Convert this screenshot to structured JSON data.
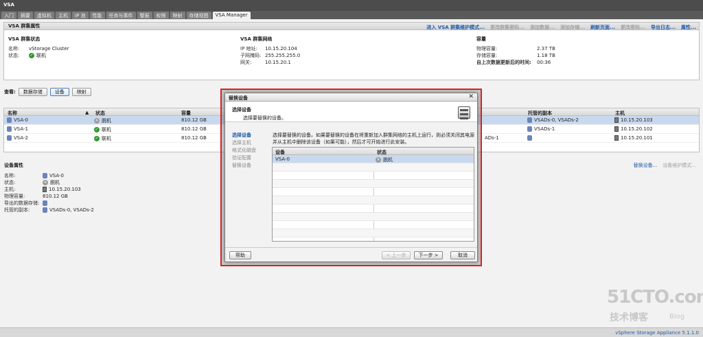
{
  "app": {
    "title": "VSA"
  },
  "tabs": [
    "入门",
    "摘要",
    "虚拟机",
    "主机",
    "IP 池",
    "性能",
    "任务与事件",
    "警报",
    "权限",
    "映射",
    "存储视图",
    "VSA Manager"
  ],
  "top_panel": {
    "header": "VSA 群集属性",
    "links": [
      {
        "label": "进入 VSA 群集维护模式...",
        "enabled": true
      },
      {
        "label": "更改群集密码...",
        "enabled": false
      },
      {
        "label": "添加数据...",
        "enabled": false
      },
      {
        "label": "添加存储...",
        "enabled": false
      },
      {
        "label": "刷新页面...",
        "enabled": true
      },
      {
        "label": "更改密码...",
        "enabled": false
      },
      {
        "label": "导出日志...",
        "enabled": true
      },
      {
        "label": "属性...",
        "enabled": true
      }
    ],
    "cluster_status": {
      "title": "VSA 群集状态",
      "name_label": "名称:",
      "name_value": "vStorage Cluster",
      "state_label": "状态:",
      "state_value": "联机"
    },
    "network": {
      "title": "VSA 群集网络",
      "ip_label": "IP 地址:",
      "ip_value": "10.15.20.104",
      "mask_label": "子网掩码:",
      "mask_value": "255.255.255.0",
      "gw_label": "网关:",
      "gw_value": "10.15.20.1"
    },
    "capacity": {
      "title": "容量",
      "phys_label": "物理容量:",
      "phys_value": "2.37 TB",
      "store_label": "存储容量:",
      "store_value": "1.18 TB",
      "update_label": "自上次数据更新后的时间:",
      "update_value": "00:36"
    }
  },
  "view_bar": {
    "label": "查看:",
    "buttons": [
      "数据存储",
      "设备",
      "映射"
    ]
  },
  "grid": {
    "headers": {
      "name": "名称",
      "state": "状态",
      "capacity": "容量",
      "replicas": "托管的副本",
      "host": "主机"
    },
    "rows": [
      {
        "name": "VSA-0",
        "state": "脱机",
        "state_kind": "off",
        "capacity": "810.12 GB",
        "replicas": "VSADs-0, VSADs-2",
        "host": "10.15.20.103",
        "selected": true
      },
      {
        "name": "VSA-1",
        "state": "联机",
        "state_kind": "ok",
        "capacity": "810.12 GB",
        "replicas": "VSADs-1",
        "host": "10.15.20.102",
        "selected": false
      },
      {
        "name": "VSA-2",
        "state": "联机",
        "state_kind": "ok",
        "capacity": "810.12 GB",
        "replicas": "",
        "host": "10.15.20.101",
        "selected": false,
        "hidden_mid": "ADs-1"
      }
    ]
  },
  "device_props": {
    "title": "设备属性",
    "links": [
      {
        "label": "替换设备...",
        "enabled": true
      },
      {
        "label": "设备维护模式...",
        "enabled": false
      }
    ],
    "items": [
      {
        "k": "名称:",
        "v": "VSA-0"
      },
      {
        "k": "状态:",
        "v": "脱机"
      },
      {
        "k": "主机:",
        "v": "10.15.20.103"
      },
      {
        "k": "物理容量:",
        "v": "810.12 GB"
      },
      {
        "k": "导出的数据存储:",
        "v": ""
      },
      {
        "k": "托管的副本:",
        "v": "VSADs-0, VSADs-2"
      }
    ]
  },
  "dialog": {
    "title": "替换设备",
    "header_title": "选择设备",
    "header_sub": "选择要替换的设备。",
    "steps": [
      "选择设备",
      "选择主机",
      "格式化磁盘",
      "验证配置",
      "替换设备"
    ],
    "instruction": "选择要替换的设备。如果要替换的设备在将重新加入群集网络的主机上运行，则必须关闭其电源并从主机中删除该设备（如果可能），然后才可开始进行此安装。",
    "table_headers": {
      "device": "设备",
      "state": "状态"
    },
    "table_rows": [
      {
        "device": "VSA-0",
        "state": "脱机"
      }
    ],
    "buttons": {
      "help": "帮助",
      "back": "< 上一步",
      "next": "下一步 >",
      "cancel": "取消"
    }
  },
  "status_bar": {
    "text": "vSphere Storage Appliance 5.1.1.0"
  },
  "watermark": {
    "line1": "51CTO.com",
    "line2": "技术博客",
    "line3": "Blog"
  },
  "colors": {
    "selection": "#c8d9ef",
    "link": "#1f5aa8",
    "highlight_border": "#e02020",
    "online": "#2e9a2e"
  }
}
